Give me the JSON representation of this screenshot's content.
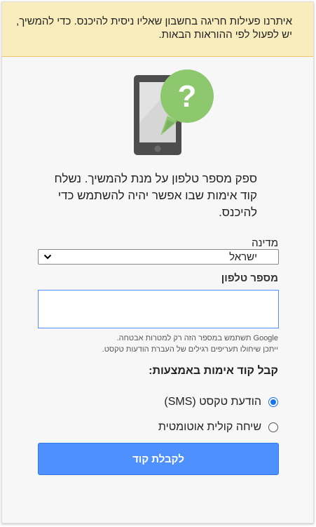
{
  "banner": {
    "text": "איתרנו פעילות חריגה בחשבון שאליו ניסית להיכנס. כדי להמשיך, יש לפעול לפי ההוראות הבאות."
  },
  "illustration": {
    "symbol": "?",
    "icon": "phone-question-icon",
    "colors": {
      "phone_body": "#4d4d4d",
      "screen": "#d6d6d6",
      "bubble": "#8dc86f"
    }
  },
  "intro": {
    "text": "ספק מספר טלפון על מנת להמשיך. נשלח קוד אימות שבו אפשר יהיה להשתמש כדי להיכנס."
  },
  "country": {
    "label": "מדינה",
    "selected": "ישראל"
  },
  "phone": {
    "label": "מספר טלפון",
    "value": "",
    "placeholder": ""
  },
  "hints": {
    "line1": "Google תשתמש במספר הזה רק למטרות אבטחה.",
    "line2": "ייתכן שיחולו תעריפים רגילים של העברת הודעות טקסט."
  },
  "method": {
    "title": "קבל קוד אימות באמצעות:",
    "options": [
      {
        "label": "הודעת טקסט (SMS)",
        "checked": true
      },
      {
        "label": "שיחה קולית אוטומטית",
        "checked": false
      }
    ]
  },
  "submit": {
    "label": "לקבלת קוד"
  },
  "colors": {
    "banner_bg": "#f9edbe",
    "accent": "#4d90fe",
    "radio_checked": "#1a73e8"
  }
}
